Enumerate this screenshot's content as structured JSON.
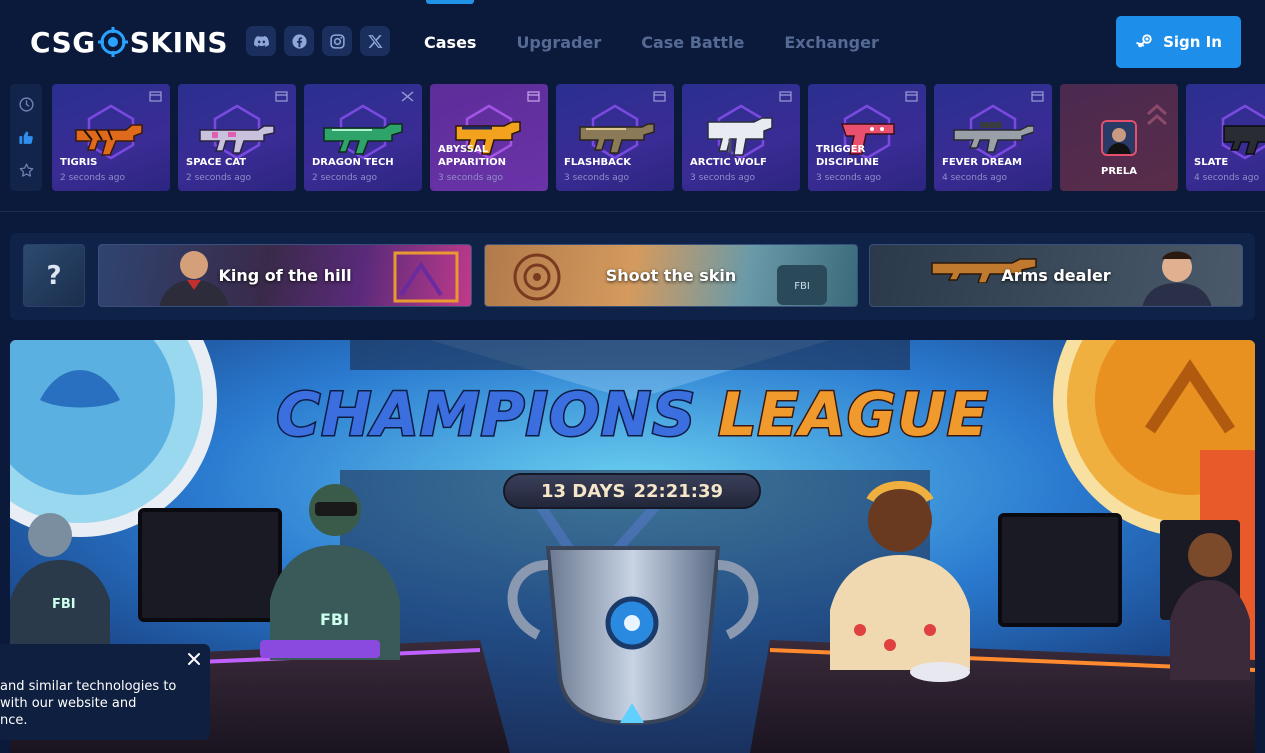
{
  "header": {
    "logo": {
      "part1": "CSG",
      "part2": "SKINS"
    },
    "socials": [
      {
        "icon": "discord-icon"
      },
      {
        "icon": "facebook-icon"
      },
      {
        "icon": "instagram-icon"
      },
      {
        "icon": "x-icon"
      }
    ],
    "nav": [
      {
        "label": "Cases",
        "active": true
      },
      {
        "label": "Upgrader",
        "active": false
      },
      {
        "label": "Case Battle",
        "active": false
      },
      {
        "label": "Exchanger",
        "active": false
      }
    ],
    "sign_in": "Sign In"
  },
  "drop_filters": [
    {
      "icon": "clock-icon"
    },
    {
      "icon": "thumbs-up-icon"
    },
    {
      "icon": "star-icon"
    }
  ],
  "drops": [
    {
      "name": "TIGRIS",
      "time": "2 seconds ago"
    },
    {
      "name": "SPACE CAT",
      "time": "2 seconds ago"
    },
    {
      "name": "DRAGON TECH",
      "time": "2 seconds ago"
    },
    {
      "name": "ABYSSAL APPARITION",
      "time": "3 seconds ago"
    },
    {
      "name": "FLASHBACK",
      "time": "3 seconds ago"
    },
    {
      "name": "ARCTIC WOLF",
      "time": "3 seconds ago"
    },
    {
      "name": "TRIGGER DISCIPLINE",
      "time": "3 seconds ago"
    },
    {
      "name": "FEVER DREAM",
      "time": "4 seconds ago"
    },
    {
      "name": "PRELA"
    },
    {
      "name": "SLATE",
      "time": "4 seconds ago"
    }
  ],
  "events": {
    "mystery": "?",
    "items": [
      {
        "title": "King of the hill"
      },
      {
        "title": "Shoot the skin"
      },
      {
        "title": "Arms dealer"
      }
    ]
  },
  "hero": {
    "title_part1": "CHAMPIONS",
    "title_part2": "LEAGUE",
    "timer_days": "13 DAYS",
    "timer_clock": "22:21:39"
  },
  "cookie": {
    "line1": "and similar technologies to",
    "line2": "with our website and",
    "line3": "nce."
  },
  "colors": {
    "background": "#0b1a3a",
    "accent": "#1d8fea",
    "nav_inactive": "#556a94"
  }
}
